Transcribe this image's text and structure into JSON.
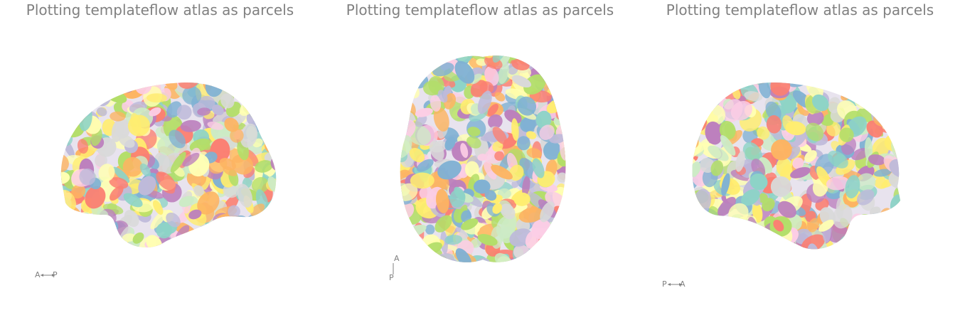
{
  "panels": [
    {
      "id": "left-lateral",
      "title": "Plotting templateflow atlas as parcels",
      "view": "lateral-left",
      "orientation": {
        "start": "A",
        "end": "P",
        "direction": "horizontal"
      }
    },
    {
      "id": "top",
      "title": "Plotting templateflow atlas as parcels",
      "view": "dorsal",
      "orientation": {
        "start": "A",
        "end": "P",
        "direction": "vertical"
      }
    },
    {
      "id": "right-lateral",
      "title": "Plotting templateflow atlas as parcels",
      "view": "lateral-right",
      "orientation": {
        "start": "P",
        "end": "A",
        "direction": "horizontal"
      }
    }
  ],
  "palette": [
    "#8dd3c7",
    "#ffffb3",
    "#bebada",
    "#fb8072",
    "#80b1d3",
    "#fdb462",
    "#b3de69",
    "#fccde5",
    "#d9d9d9",
    "#bc80bd",
    "#ccebc5",
    "#ffed6f"
  ],
  "title_color": "#808080"
}
